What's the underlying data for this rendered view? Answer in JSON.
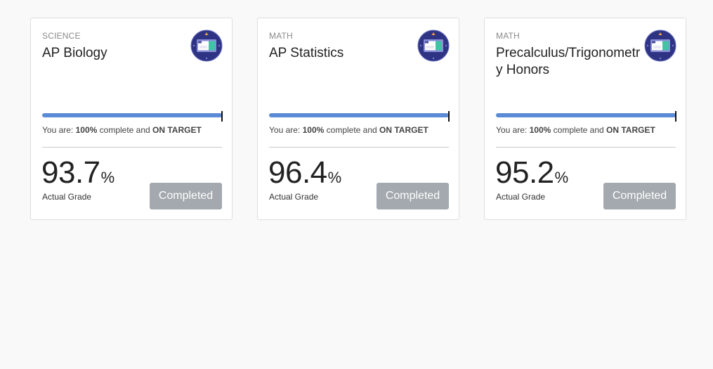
{
  "accent_colors": {
    "progress": "#5b8bd6",
    "button": "#a3a9ae",
    "badge": "#2e3383"
  },
  "badge_icon": "course-badge-icon",
  "cards": [
    {
      "category": "SCIENCE",
      "title": "AP Biology",
      "progress_percent": 100,
      "status_prefix": "You are: ",
      "progress_text": "100%",
      "status_mid": " complete and ",
      "target_text": "ON TARGET",
      "grade_value": "93.7",
      "grade_unit": "%",
      "grade_label": "Actual Grade",
      "button_label": "Completed"
    },
    {
      "category": "MATH",
      "title": "AP Statistics",
      "progress_percent": 100,
      "status_prefix": "You are: ",
      "progress_text": "100%",
      "status_mid": " complete and ",
      "target_text": "ON TARGET",
      "grade_value": "96.4",
      "grade_unit": "%",
      "grade_label": "Actual Grade",
      "button_label": "Completed"
    },
    {
      "category": "MATH",
      "title": "Precalculus/Trigonometry Honors",
      "progress_percent": 100,
      "status_prefix": "You are: ",
      "progress_text": "100%",
      "status_mid": " complete and ",
      "target_text": "ON TARGET",
      "grade_value": "95.2",
      "grade_unit": "%",
      "grade_label": "Actual Grade",
      "button_label": "Completed"
    }
  ]
}
